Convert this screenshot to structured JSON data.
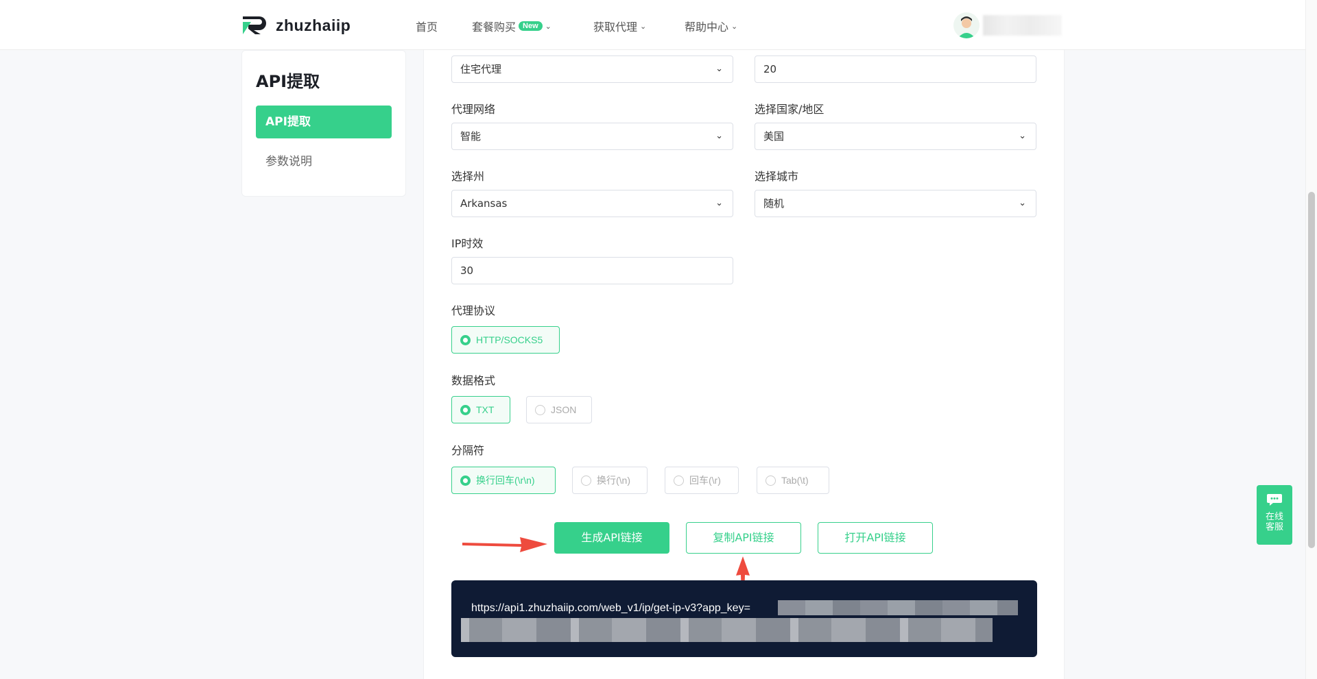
{
  "brand": {
    "name": "zhuzhaiip"
  },
  "nav": {
    "home": "首页",
    "packages": "套餐购买",
    "packages_badge": "New",
    "get_proxy": "获取代理",
    "help": "帮助中心"
  },
  "sidebar": {
    "title": "API提取",
    "items": [
      {
        "label": "API提取",
        "active": true
      },
      {
        "label": "参数说明",
        "active": false
      }
    ]
  },
  "form": {
    "proxy_type": {
      "value": "住宅代理"
    },
    "quantity": {
      "value": "20"
    },
    "network": {
      "label": "代理网络",
      "value": "智能"
    },
    "country": {
      "label": "选择国家/地区",
      "value": "美国"
    },
    "state": {
      "label": "选择州",
      "value": "Arkansas"
    },
    "city": {
      "label": "选择城市",
      "value": "随机"
    },
    "ip_duration": {
      "label": "IP时效",
      "value": "30"
    },
    "protocol": {
      "label": "代理协议",
      "options": [
        "HTTP/SOCKS5"
      ],
      "selected": "HTTP/SOCKS5"
    },
    "format": {
      "label": "数据格式",
      "options": [
        "TXT",
        "JSON"
      ],
      "selected": "TXT"
    },
    "separator": {
      "label": "分隔符",
      "options": [
        "换行回车(\\r\\n)",
        "换行(\\n)",
        "回车(\\r)",
        "Tab(\\t)"
      ],
      "selected": "换行回车(\\r\\n)"
    }
  },
  "buttons": {
    "generate": "生成API链接",
    "copy": "复制API链接",
    "open": "打开API链接"
  },
  "result": {
    "url_prefix": "https://api1.zhuzhaiip.com/web_v1/ip/get-ip-v3?app_key="
  },
  "service": {
    "line1": "在线",
    "line2": "客服",
    "icon": "chat-bubble-icon"
  },
  "colors": {
    "accent": "#36d08b",
    "result_bg": "#0f1b34",
    "arrow": "#ee4b3e"
  }
}
